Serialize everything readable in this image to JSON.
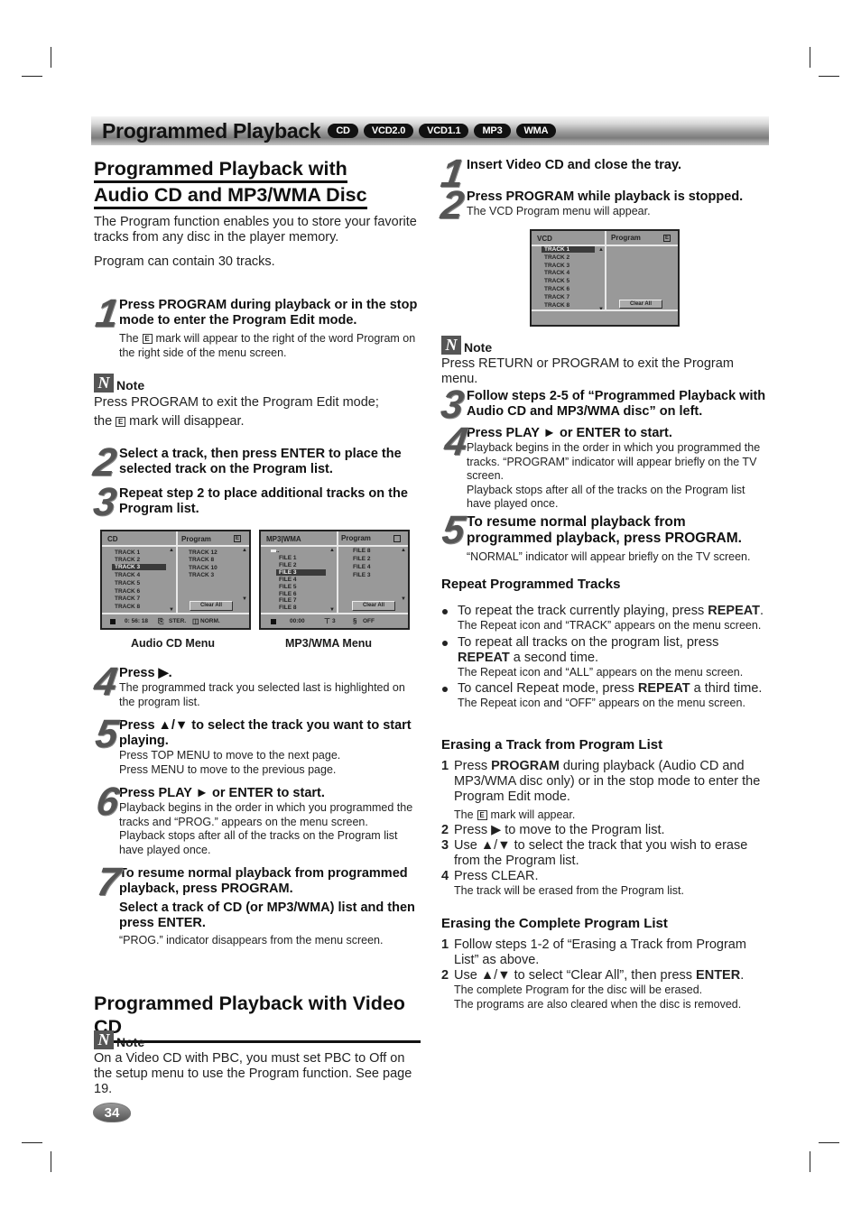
{
  "banner": {
    "title": "Programmed Playback",
    "badges": [
      "CD",
      "VCD2.0",
      "VCD1.1",
      "MP3",
      "WMA"
    ]
  },
  "left": {
    "heading_line1": "Programmed Playback with",
    "heading_line2": "Audio CD and MP3/WMA Disc",
    "intro": "The Program function enables you to store your favorite tracks from any disc in the player memory.",
    "capacity": "Program can contain 30 tracks.",
    "step1": {
      "num": "1",
      "bold": "Press PROGRAM during playback or in the stop mode to enter the Program Edit mode.",
      "text_pre": "The",
      "text_post": "mark will appear to the right of the word Program on the right side of the menu screen."
    },
    "note1": {
      "label": "Note",
      "line1": "Press PROGRAM to exit the Program Edit mode;",
      "line2_pre": "the",
      "line2_post": "mark will disappear."
    },
    "step2": {
      "num": "2",
      "bold": "Select a track, then press ENTER to place the selected track on the Program list."
    },
    "step3": {
      "num": "3",
      "bold": "Repeat step 2 to place additional tracks on the Program list."
    },
    "cd_menu": {
      "title": "CD",
      "program": "Program",
      "emark": "E",
      "tracks": [
        "TRACK 1",
        "TRACK 2",
        "TRACK 3",
        "TRACK 4",
        "TRACK 5",
        "TRACK 6",
        "TRACK 7",
        "TRACK 8"
      ],
      "selected_index": 2,
      "program_list": [
        "TRACK 12",
        "TRACK 8",
        "TRACK 10",
        "TRACK 3"
      ],
      "clear_all": "Clear All",
      "time": "0: 56: 18",
      "audio": "STER.",
      "sound": "NORM.",
      "caption": "Audio CD Menu"
    },
    "mp3_menu": {
      "title": "MP3|WMA",
      "program": "Program",
      "folder": "..",
      "files": [
        "FILE 1",
        "FILE 2",
        "FILE 3",
        "FILE 4",
        "FILE 5",
        "FILE 6",
        "FILE 7",
        "FILE 8"
      ],
      "selected_index": 2,
      "program_list": [
        "FILE 8",
        "FILE 2",
        "FILE 4",
        "FILE 3"
      ],
      "clear_all": "Clear All",
      "time": "00:00",
      "track_count": "3",
      "repeat": "OFF",
      "caption": "MP3/WMA Menu"
    },
    "step4": {
      "num": "4",
      "bold": "Press ▶.",
      "text": "The programmed track you selected last is highlighted on the program list."
    },
    "step5": {
      "num": "5",
      "bold": "Press ▲/▼ to select the track you want to start playing.",
      "text1": "Press TOP MENU to move to the next page.",
      "text2": "Press MENU to move to the previous page."
    },
    "step6": {
      "num": "6",
      "bold": "Press PLAY ► or ENTER to start.",
      "text1": "Playback begins in the order in which you programmed the tracks and “PROG.” appears on the menu screen.",
      "text2": "Playback stops after all of the tracks on the Program list have played once."
    },
    "step7": {
      "num": "7",
      "bold1": "To resume normal playback from programmed playback, press PROGRAM.",
      "bold2": "Select a track of CD (or MP3/WMA) list and then press ENTER.",
      "text": "“PROG.” indicator disappears from the menu screen."
    },
    "vcd_heading": "Programmed Playback with Video CD",
    "note2": {
      "label": "Note",
      "text": "On a Video CD with PBC, you must set PBC to Off on the setup menu to use the Program function. See page 19."
    }
  },
  "right": {
    "step1": {
      "num": "1",
      "bold": "Insert Video CD and close the tray."
    },
    "step2": {
      "num": "2",
      "bold": "Press PROGRAM while playback is stopped.",
      "text": "The VCD Program menu will appear."
    },
    "vcd_menu": {
      "title": "VCD",
      "program": "Program",
      "emark": "E",
      "tracks": [
        "TRACK 1",
        "TRACK 2",
        "TRACK 3",
        "TRACK 4",
        "TRACK 5",
        "TRACK 6",
        "TRACK 7",
        "TRACK 8"
      ],
      "selected_index": 0,
      "clear_all": "Clear All"
    },
    "note": {
      "label": "Note",
      "text": "Press RETURN or PROGRAM to exit the Program menu."
    },
    "step3": {
      "num": "3",
      "bold": "Follow steps 2-5 of “Programmed Playback with Audio CD and MP3/WMA disc” on left."
    },
    "step4": {
      "num": "4",
      "bold": "Press PLAY ► or ENTER to start.",
      "text1": "Playback begins in the order in which you programmed the tracks. “PROGRAM” indicator will appear briefly on the TV screen.",
      "text2": "Playback stops after all of the tracks on the Program list have played once."
    },
    "step5": {
      "num": "5",
      "bold": "To resume normal playback from programmed playback, press PROGRAM.",
      "text": "“NORMAL” indicator will appear briefly on the TV screen."
    },
    "repeat": {
      "heading": "Repeat Programmed Tracks",
      "items": [
        {
          "pre": "To repeat the track currently playing, press ",
          "key": "REPEAT",
          "post": ".",
          "sub": "The Repeat icon and “TRACK” appears on the menu screen."
        },
        {
          "pre": "To repeat all tracks on the program list, press ",
          "key": "REPEAT",
          "post": " a second time.",
          "sub": "The Repeat icon and “ALL” appears on the menu screen."
        },
        {
          "pre": "To cancel Repeat mode, press ",
          "key": "REPEAT",
          "post": " a third time.",
          "sub": "The Repeat icon and “OFF” appears on the menu screen."
        }
      ]
    },
    "erase_track": {
      "heading": "Erasing a Track from Program List",
      "i1_pre": "Press ",
      "i1_key": "PROGRAM",
      "i1_post": " during playback (Audio CD and MP3/WMA disc only) or in the stop mode to enter the Program Edit mode.",
      "i1_sub_pre": "The",
      "i1_sub_post": "mark will appear.",
      "i2": "Press ▶ to move to the Program list.",
      "i3": "Use ▲/▼ to select the track that you wish to erase from the Program list.",
      "i4": "Press CLEAR.",
      "i4_sub": "The track will be erased from the Program list."
    },
    "erase_all": {
      "heading": "Erasing the Complete Program List",
      "i1": "Follow steps 1-2 of “Erasing a Track from Program List” as above.",
      "i2_pre": "Use ▲/▼ to select “Clear All”, then press ",
      "i2_key": "ENTER",
      "i2_post": ".",
      "sub1": "The complete Program for the disc will be erased.",
      "sub2": "The programs are also cleared when the disc is removed."
    }
  },
  "page_number": "34"
}
